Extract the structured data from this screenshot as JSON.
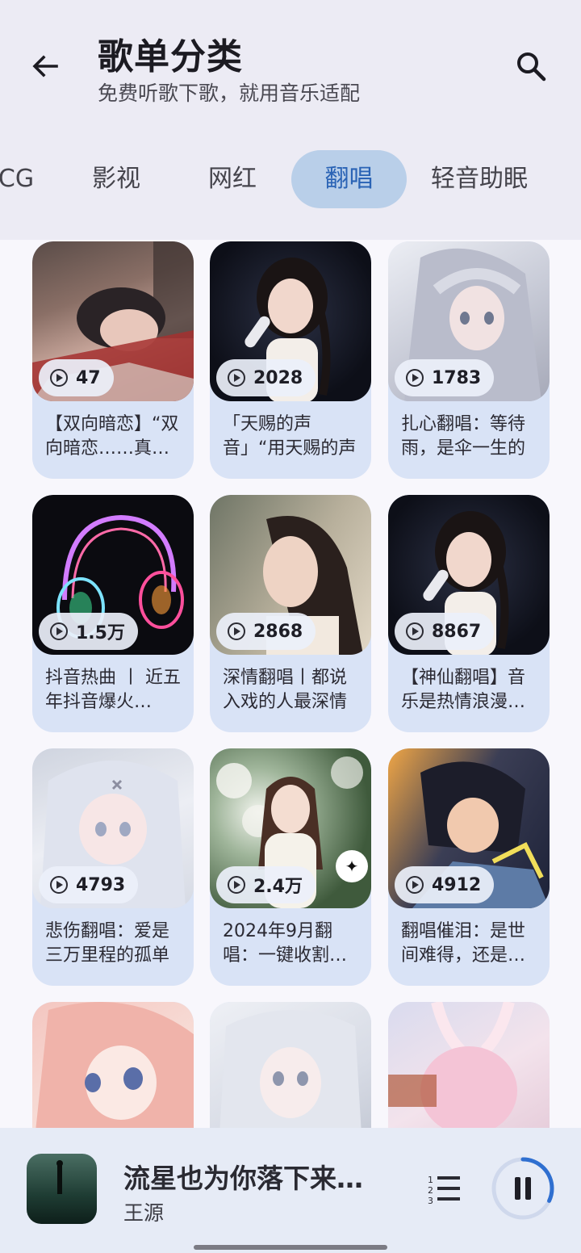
{
  "header": {
    "title": "歌单分类",
    "subtitle": "免费听歌下歌，就用音乐适配"
  },
  "tabs": [
    {
      "label": "CG",
      "active": false
    },
    {
      "label": "影视",
      "active": false
    },
    {
      "label": "网红",
      "active": false
    },
    {
      "label": "翻唱",
      "active": true
    },
    {
      "label": "轻音助眠",
      "active": false
    }
  ],
  "playlists": [
    {
      "plays": "47",
      "title": "【双向暗恋】“双向暗恋……真…"
    },
    {
      "plays": "2028",
      "title": "「天赐的声音」“用天赐的声音…"
    },
    {
      "plays": "1783",
      "title": "扎心翻唱：等待雨，是伞一生的"
    },
    {
      "plays": "1.5万",
      "title": "抖音热曲 丨 近五年抖音爆火…"
    },
    {
      "plays": "2868",
      "title": "深情翻唱丨都说入戏的人最深情"
    },
    {
      "plays": "8867",
      "title": "【神仙翻唱】音乐是热情浪漫…"
    },
    {
      "plays": "4793",
      "title": "悲伤翻唱：爱是三万里程的孤单"
    },
    {
      "plays": "2.4万",
      "title": "2024年9月翻唱：一键收割…"
    },
    {
      "plays": "4912",
      "title": "翻唱催泪：是世间难得，还是…"
    }
  ],
  "player": {
    "song": "流星也为你落下来…",
    "artist": "王源",
    "progress": 0.32
  },
  "colors": {
    "accent": "#2a63b5",
    "tab_active_bg": "#b9cfe9",
    "card_bg": "#d9e3f6"
  }
}
